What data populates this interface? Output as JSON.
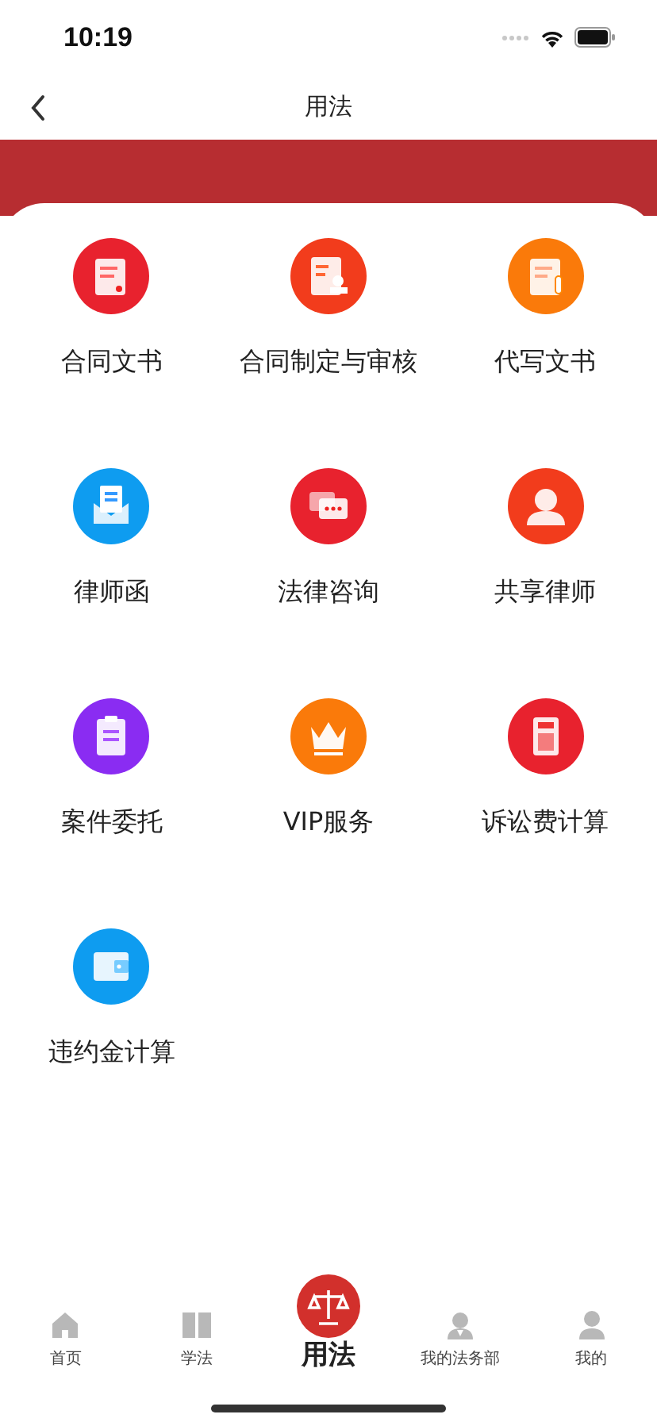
{
  "status_bar": {
    "time": "10:19"
  },
  "nav": {
    "title": "用法"
  },
  "services": [
    {
      "label": "合同文书",
      "kind": "document",
      "color": "#e8222e"
    },
    {
      "label": "合同制定与审核",
      "kind": "stamp",
      "color": "#f23c1c"
    },
    {
      "label": "代写文书",
      "kind": "pen",
      "color": "#fa7a0a"
    },
    {
      "label": "律师函",
      "kind": "envelope",
      "color": "#0e9cf0"
    },
    {
      "label": "法律咨询",
      "kind": "chat",
      "color": "#e8222e"
    },
    {
      "label": "共享律师",
      "kind": "person",
      "color": "#f23c1c"
    },
    {
      "label": "案件委托",
      "kind": "clipboard",
      "color": "#8a2cf2"
    },
    {
      "label": "VIP服务",
      "kind": "crown",
      "color": "#fa7a0a"
    },
    {
      "label": "诉讼费计算",
      "kind": "calculator",
      "color": "#e8222e"
    },
    {
      "label": "违约金计算",
      "kind": "wallet",
      "color": "#0e9cf0"
    }
  ],
  "tabs": [
    {
      "label": "首页",
      "kind": "home",
      "selected": false
    },
    {
      "label": "学法",
      "kind": "book",
      "selected": false
    },
    {
      "label": "用法",
      "kind": "scale",
      "selected": true
    },
    {
      "label": "我的法务部",
      "kind": "lawyer",
      "selected": false
    },
    {
      "label": "我的",
      "kind": "user",
      "selected": false
    }
  ]
}
